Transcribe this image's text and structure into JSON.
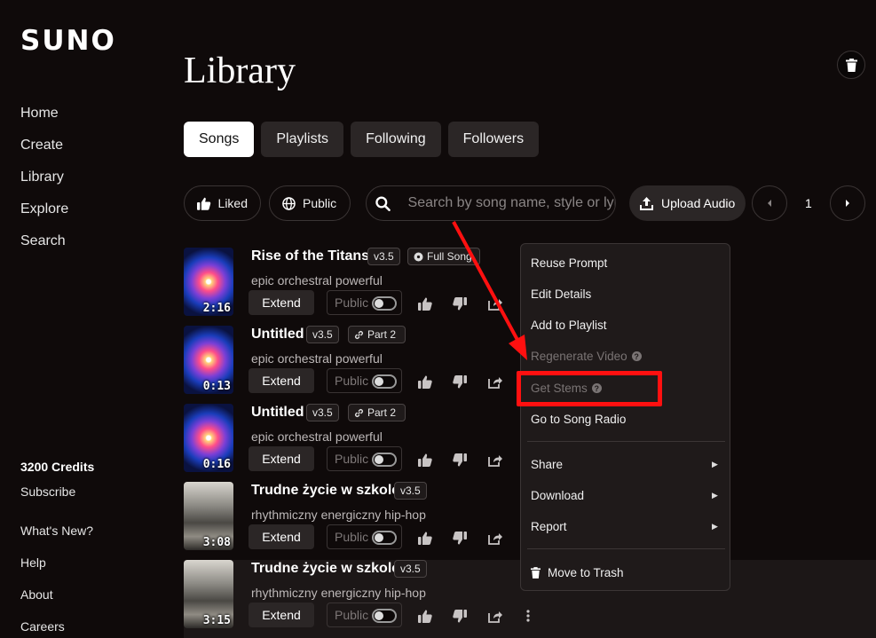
{
  "app": {
    "logo": "SUNO"
  },
  "sidebar": {
    "nav": [
      "Home",
      "Create",
      "Library",
      "Explore",
      "Search"
    ],
    "credits": "3200 Credits",
    "subscribe": "Subscribe",
    "links": [
      "What's New?",
      "Help",
      "About",
      "Careers"
    ]
  },
  "header": {
    "title": "Library"
  },
  "tabs": [
    "Songs",
    "Playlists",
    "Following",
    "Followers"
  ],
  "filters": {
    "liked": "Liked",
    "public": "Public",
    "search_placeholder": "Search by song name, style or lyrics",
    "upload": "Upload Audio",
    "page": "1"
  },
  "songs": [
    {
      "title": "Rise of the Titans",
      "version": "v3.5",
      "tag": "Full Song",
      "style": "epic orchestral powerful",
      "duration": "2:16",
      "extend": "Extend",
      "public": "Public"
    },
    {
      "title": "Untitled",
      "version": "v3.5",
      "tag": "Part 2",
      "style": "epic orchestral powerful",
      "duration": "0:13",
      "extend": "Extend",
      "public": "Public"
    },
    {
      "title": "Untitled",
      "version": "v3.5",
      "tag": "Part 2",
      "style": "epic orchestral powerful",
      "duration": "0:16",
      "extend": "Extend",
      "public": "Public"
    },
    {
      "title": "Trudne życie w szkole",
      "version": "v3.5",
      "tag": "",
      "style": "rhythmiczny energiczny hip-hop",
      "duration": "3:08",
      "extend": "Extend",
      "public": "Public"
    },
    {
      "title": "Trudne życie w szkole",
      "version": "v3.5",
      "tag": "",
      "style": "rhythmiczny energiczny hip-hop",
      "duration": "3:15",
      "extend": "Extend",
      "public": "Public"
    }
  ],
  "menu": {
    "reuse_prompt": "Reuse Prompt",
    "edit_details": "Edit Details",
    "add_to_playlist": "Add to Playlist",
    "regenerate_video": "Regenerate Video",
    "get_stems": "Get Stems",
    "song_radio": "Go to Song Radio",
    "share": "Share",
    "download": "Download",
    "report": "Report",
    "move_to_trash": "Move to Trash"
  },
  "colors": {
    "highlight": "#ff1010",
    "background": "#0f0a0a",
    "surface": "#2b2626"
  }
}
